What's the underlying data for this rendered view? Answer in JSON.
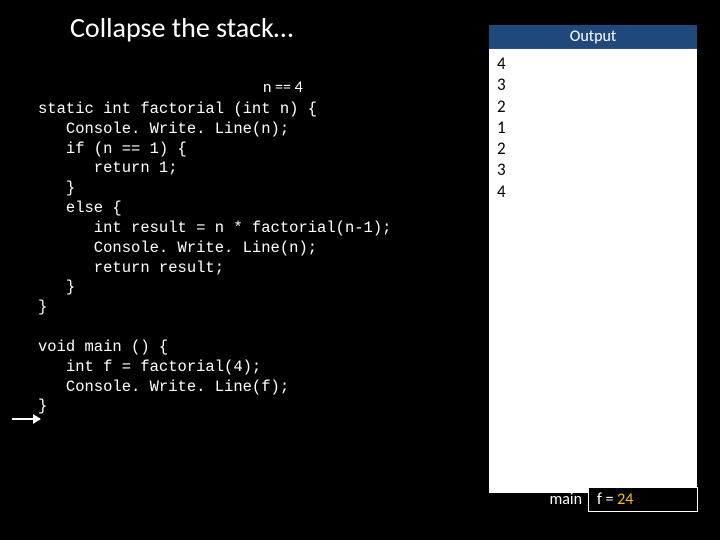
{
  "title": "Collapse the stack…",
  "annotation": "n == 4",
  "code": "static int factorial (int n) {\n   Console. Write. Line(n);\n   if (n == 1) {\n      return 1;\n   }\n   else {\n      int result = n * factorial(n-1);\n      Console. Write. Line(n);\n      return result;\n   }\n}\n\nvoid main () {\n   int f = factorial(4);\n   Console. Write. Line(f);\n}",
  "output": {
    "header": "Output",
    "lines": [
      "4",
      "3",
      "2",
      "1",
      "2",
      "3",
      "4"
    ]
  },
  "stack": {
    "label": "main",
    "frame_prefix": "f = ",
    "frame_value": "24"
  }
}
